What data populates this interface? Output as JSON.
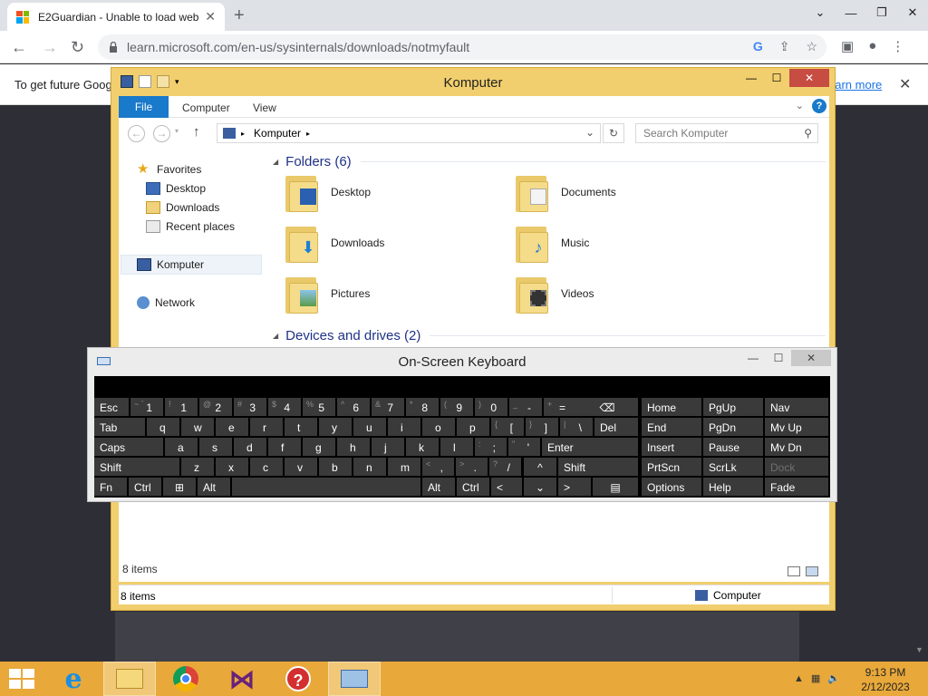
{
  "browser": {
    "tab_title": "E2Guardian - Unable to load web",
    "tab_close": "✕",
    "new_tab": "+",
    "url": "learn.microsoft.com/en-us/sysinternals/downloads/notmyfault",
    "infobar_text": "To get future Goog",
    "infobar_link": "earn more",
    "infobar_close": "✕",
    "window_controls": [
      "⌄",
      "—",
      "❐",
      "✕"
    ]
  },
  "explorer": {
    "title": "Komputer",
    "ribbon_tabs": [
      "File",
      "Computer",
      "View"
    ],
    "address": "Komputer",
    "search_placeholder": "Search Komputer",
    "nav": {
      "favorites": "Favorites",
      "desktop": "Desktop",
      "downloads": "Downloads",
      "recent": "Recent places",
      "computer": "Komputer",
      "network": "Network"
    },
    "folders_header": "Folders (6)",
    "folders": [
      "Desktop",
      "Documents",
      "Downloads",
      "Music",
      "Pictures",
      "Videos"
    ],
    "devices_header": "Devices and drives (2)",
    "items_count_inner": "8 items",
    "status_left": "8 items",
    "status_right": "Computer"
  },
  "osk": {
    "title": "On-Screen Keyboard",
    "keys": {
      "esc": "Esc",
      "tab": "Tab",
      "caps": "Caps",
      "shift_l": "Shift",
      "fn": "Fn",
      "ctrl_l": "Ctrl",
      "alt_l": "Alt",
      "alt_r": "Alt",
      "ctrl_r": "Ctrl",
      "del": "Del",
      "enter": "Enter",
      "shift_r": "Shift",
      "home": "Home",
      "pgup": "PgUp",
      "nav": "Nav",
      "end": "End",
      "pgdn": "PgDn",
      "mvup": "Mv Up",
      "insert": "Insert",
      "pause": "Pause",
      "mvdn": "Mv Dn",
      "prtscn": "PrtScn",
      "scrlk": "ScrLk",
      "dock": "Dock",
      "options": "Options",
      "help": "Help",
      "fade": "Fade",
      "left": "<",
      "down": "⌄",
      "right": ">",
      "up": "^"
    },
    "row1": [
      [
        "~ `",
        "1"
      ],
      [
        "!",
        "1"
      ],
      [
        "@",
        "2"
      ],
      [
        "#",
        "3"
      ],
      [
        "$",
        "4"
      ],
      [
        "%",
        "5"
      ],
      [
        "^",
        "6"
      ],
      [
        "&",
        "7"
      ],
      [
        "*",
        "8"
      ],
      [
        "(",
        "9"
      ],
      [
        ")",
        "0"
      ],
      [
        "_",
        "-"
      ],
      [
        "+",
        "="
      ]
    ],
    "row2_letters": [
      "q",
      "w",
      "e",
      "r",
      "t",
      "y",
      "u",
      "i",
      "o",
      "p"
    ],
    "row2_sym": [
      [
        "{",
        "["
      ],
      [
        "}",
        "]"
      ],
      [
        "|",
        "\\"
      ]
    ],
    "row3_letters": [
      "a",
      "s",
      "d",
      "f",
      "g",
      "h",
      "j",
      "k",
      "l"
    ],
    "row3_sym": [
      [
        ":",
        ";"
      ],
      [
        "\"",
        "'"
      ]
    ],
    "row4_letters": [
      "z",
      "x",
      "c",
      "v",
      "b",
      "n",
      "m"
    ],
    "row4_sym": [
      [
        "<",
        ","
      ],
      [
        ">",
        "."
      ],
      [
        "?",
        "/"
      ]
    ]
  },
  "taskbar": {
    "time": "9:13 PM",
    "date": "2/12/2023"
  }
}
